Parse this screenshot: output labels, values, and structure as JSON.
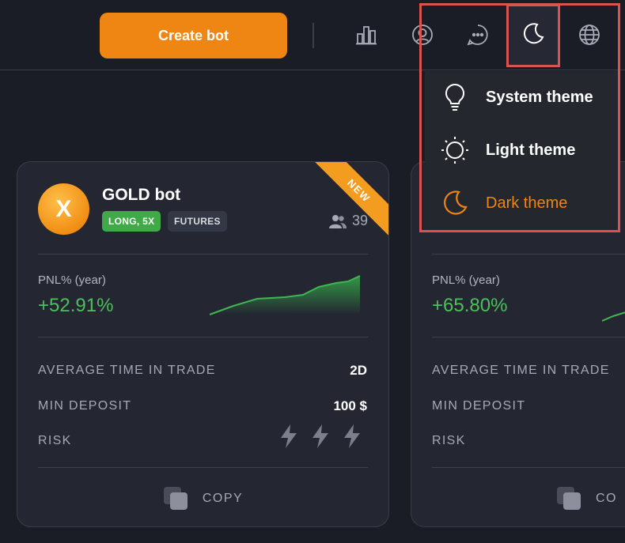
{
  "header": {
    "create_bot_label": "Create bot",
    "icons": [
      "bar-chart-icon",
      "user-circle-icon",
      "chat-icon",
      "moon-icon",
      "globe-icon"
    ]
  },
  "theme_menu": {
    "items": [
      {
        "label": "System theme",
        "icon": "lightbulb-icon",
        "active": false
      },
      {
        "label": "Light theme",
        "icon": "sun-icon",
        "active": false
      },
      {
        "label": "Dark theme",
        "icon": "moon-icon",
        "active": true
      }
    ],
    "highlight_color": "#d9534f",
    "active_color": "#ef8512"
  },
  "cards": [
    {
      "avatar_letter": "X",
      "name": "GOLD bot",
      "tags": [
        "LONG, 5X",
        "FUTURES"
      ],
      "followers": "39",
      "badge": "NEW",
      "pnl_label": "PNL% (year)",
      "pnl_value": "+52.91%",
      "avg_time_label": "AVERAGE TIME IN TRADE",
      "avg_time_value": "2D",
      "min_deposit_label": "MIN DEPOSIT",
      "min_deposit_value": "100 $",
      "risk_label": "RISK",
      "risk_level": 3,
      "copy_label": "COPY"
    },
    {
      "pnl_label": "PNL% (year)",
      "pnl_value": "+65.80%",
      "avg_time_label": "AVERAGE TIME IN TRADE",
      "min_deposit_label": "MIN DEPOSIT",
      "risk_label": "RISK",
      "copy_label": "CO"
    }
  ],
  "colors": {
    "accent": "#ef8512",
    "positive": "#4cc05a",
    "background": "#1b1d26",
    "card": "#242731"
  }
}
